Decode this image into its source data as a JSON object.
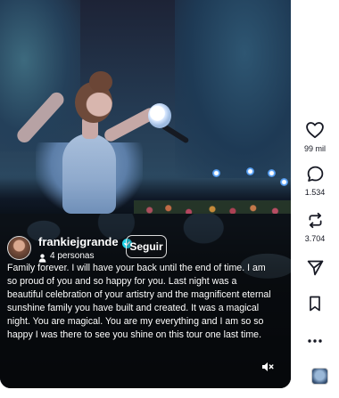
{
  "post": {
    "author": "frankiejgrande",
    "people_count": "4 personas",
    "follow_label": "Seguir",
    "caption": "Family forever. I will have your back until the end of time. I am so proud of you and so happy for you. Last night was a beautiful celebration of your artistry and the magnificent eternal sunshine family you have built and created. It was a magical night. You are magical. You are my everything and I am so so happy I was there to see you shine on this tour one last time."
  },
  "actions": {
    "likes": "99 mil",
    "comments": "1.534",
    "shares": "3.704"
  },
  "icons": {
    "like": "heart-icon",
    "comment": "comment-icon",
    "repost": "repost-icon",
    "share": "send-icon",
    "save": "bookmark-icon",
    "more": "more-icon",
    "mute": "muted-speaker-icon",
    "verified": "verified-badge-icon",
    "people": "person-icon"
  },
  "colors": {
    "verified": "#20d5ec",
    "text_dark": "#161823"
  }
}
